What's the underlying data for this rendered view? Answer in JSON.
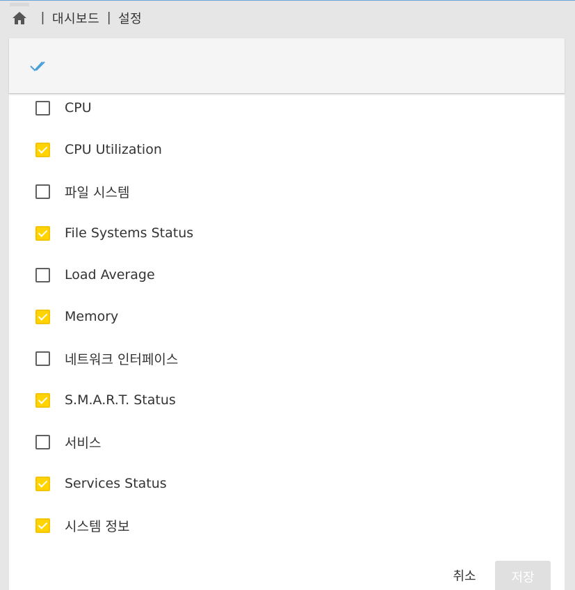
{
  "breadcrumb": {
    "home_icon": "home-icon",
    "separator": "|",
    "items": [
      "대시보드",
      "설정"
    ]
  },
  "toolbar": {
    "select_all_icon": "double-check-icon",
    "accent_color": "#4a9fd8"
  },
  "widgets": [
    {
      "label": "CPU",
      "checked": false
    },
    {
      "label": "CPU Utilization",
      "checked": true
    },
    {
      "label": "파일 시스템",
      "checked": false
    },
    {
      "label": "File Systems Status",
      "checked": true
    },
    {
      "label": "Load Average",
      "checked": false
    },
    {
      "label": "Memory",
      "checked": true
    },
    {
      "label": "네트워크 인터페이스",
      "checked": false
    },
    {
      "label": "S.M.A.R.T. Status",
      "checked": true
    },
    {
      "label": "서비스",
      "checked": false
    },
    {
      "label": "Services Status",
      "checked": true
    },
    {
      "label": "시스템 정보",
      "checked": true
    }
  ],
  "footer": {
    "cancel_label": "취소",
    "save_label": "저장"
  },
  "colors": {
    "checkbox_checked": "#ffd400",
    "save_disabled": "#e0e0e0"
  }
}
